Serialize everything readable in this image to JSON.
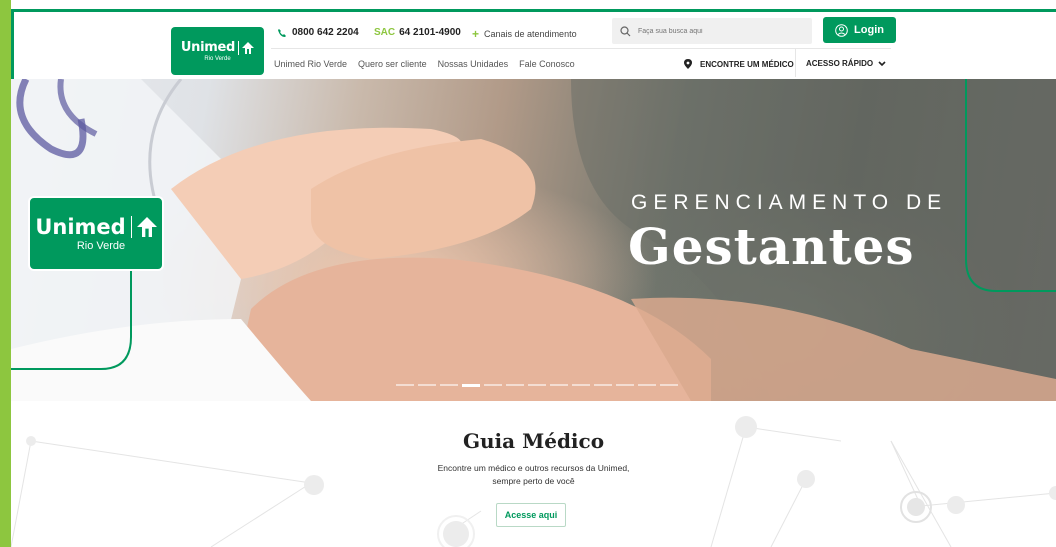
{
  "header": {
    "logo": {
      "name": "Unimed",
      "city": "Rio Verde"
    },
    "phone": "0800 642 2204",
    "sac_label": "SAC",
    "sac_number": "64 2101-4900",
    "channels": "Canais de atendimento",
    "search_placeholder": "Faça sua busca aqui",
    "login_label": "Login",
    "nav": [
      "Unimed Rio Verde",
      "Quero ser cliente",
      "Nossas Unidades",
      "Fale Conosco"
    ],
    "find_doctor": "ENCONTRE UM MÉDICO",
    "quick_access": "ACESSO RÁPIDO"
  },
  "hero": {
    "subtitle": "GERENCIAMENTO DE",
    "title": "Gestantes",
    "logo": {
      "name": "Unimed",
      "city": "Rio Verde"
    },
    "slide_count": 13,
    "active_slide": 3
  },
  "guia": {
    "title": "Guia Médico",
    "line1": "Encontre um médico e outros recursos da Unimed,",
    "line2": "sempre perto de você",
    "button": "Acesse aqui"
  },
  "colors": {
    "primary": "#00995d",
    "accent": "#8dc63f"
  }
}
